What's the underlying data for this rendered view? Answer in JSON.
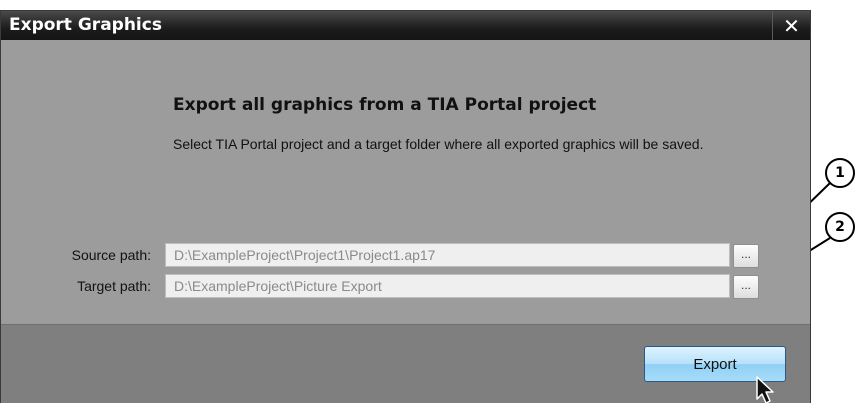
{
  "window": {
    "title": "Export Graphics",
    "close_glyph": "✕"
  },
  "main": {
    "heading": "Export all graphics from a TIA Portal project",
    "description": "Select TIA Portal project and a target folder where all exported graphics will be saved."
  },
  "source": {
    "label": "Source path:",
    "value": "D:\\ExampleProject\\Project1\\Project1.ap17",
    "browse_label": "..."
  },
  "target": {
    "label": "Target path:",
    "value": "D:\\ExampleProject\\Picture Export",
    "browse_label": "..."
  },
  "footer": {
    "export_label": "Export"
  },
  "callouts": [
    "1",
    "2"
  ],
  "icons": {
    "close": "close-icon",
    "cursor": "mouse-pointer-icon"
  }
}
